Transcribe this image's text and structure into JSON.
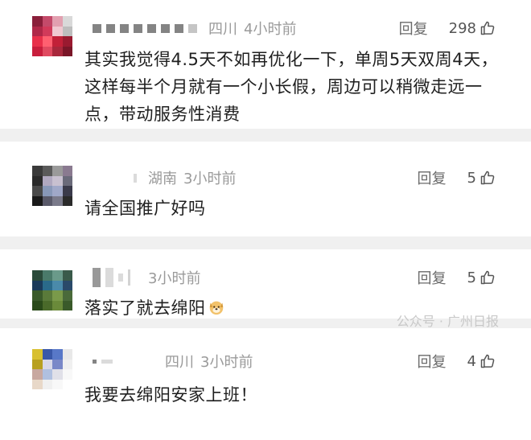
{
  "comments": [
    {
      "location": "四川",
      "time": "4小时前",
      "reply_label": "回复",
      "likes": "298",
      "text": "其实我觉得4.5天不如再优化一下，单周5天双周4天，这样每半个月就有一个小长假，周边可以稍微走远一点，带动服务性消费"
    },
    {
      "location": "湖南",
      "time": "3小时前",
      "reply_label": "回复",
      "likes": "5",
      "text": "请全国推广好吗"
    },
    {
      "location": "",
      "time": "3小时前",
      "reply_label": "回复",
      "likes": "5",
      "text": "落实了就去绵阳"
    },
    {
      "location": "四川",
      "time": "3小时前",
      "reply_label": "回复",
      "likes": "4",
      "text": "我要去绵阳安家上班！"
    }
  ],
  "watermark": "公众号 · 广州日报",
  "colors": {
    "background": "#f0f0f0",
    "card": "#ffffff",
    "meta_text": "#9a9a9a",
    "body_text": "#1f1f1f"
  },
  "icons": {
    "like": "thumbs-up-outline",
    "emoji": "dog-face-emoji"
  }
}
